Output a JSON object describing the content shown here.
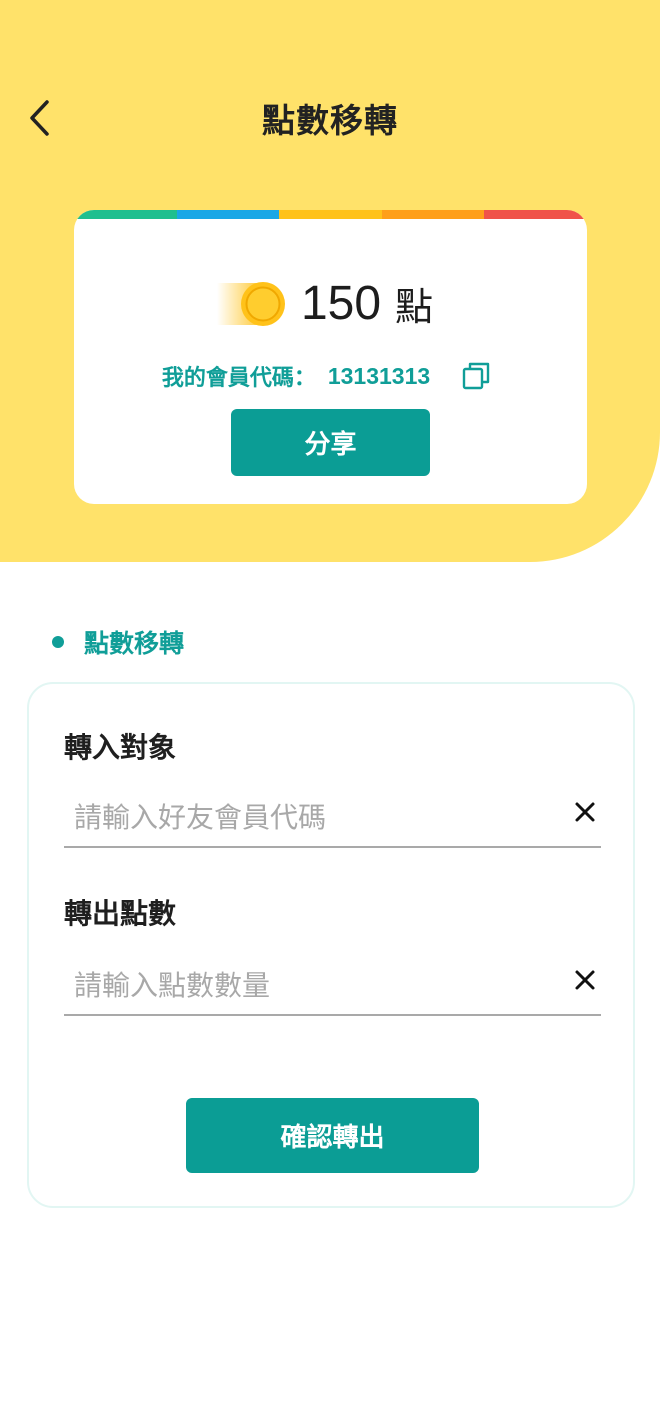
{
  "header": {
    "title": "點數移轉",
    "back_icon": "chevron-left-icon"
  },
  "points_card": {
    "stripe_colors": [
      "#1fbf8f",
      "#1aa7e6",
      "#ffc21a",
      "#ff9f1a",
      "#f0534a"
    ],
    "points_value": "150",
    "points_unit": "點",
    "member_label": "我的會員代碼：",
    "member_code": "13131313",
    "copy_icon": "copy-icon",
    "share_label": "分享"
  },
  "section": {
    "title": "點數移轉"
  },
  "form": {
    "target_label": "轉入對象",
    "target_placeholder": "請輸入好友會員代碼",
    "target_value": "",
    "amount_label": "轉出點數",
    "amount_placeholder": "請輸入點數數量",
    "amount_value": "",
    "clear_icon": "close-icon",
    "confirm_label": "確認轉出"
  },
  "colors": {
    "hero_background": "#ffe26a",
    "accent_teal": "#0b9d95",
    "coin": "#ffc21a"
  }
}
